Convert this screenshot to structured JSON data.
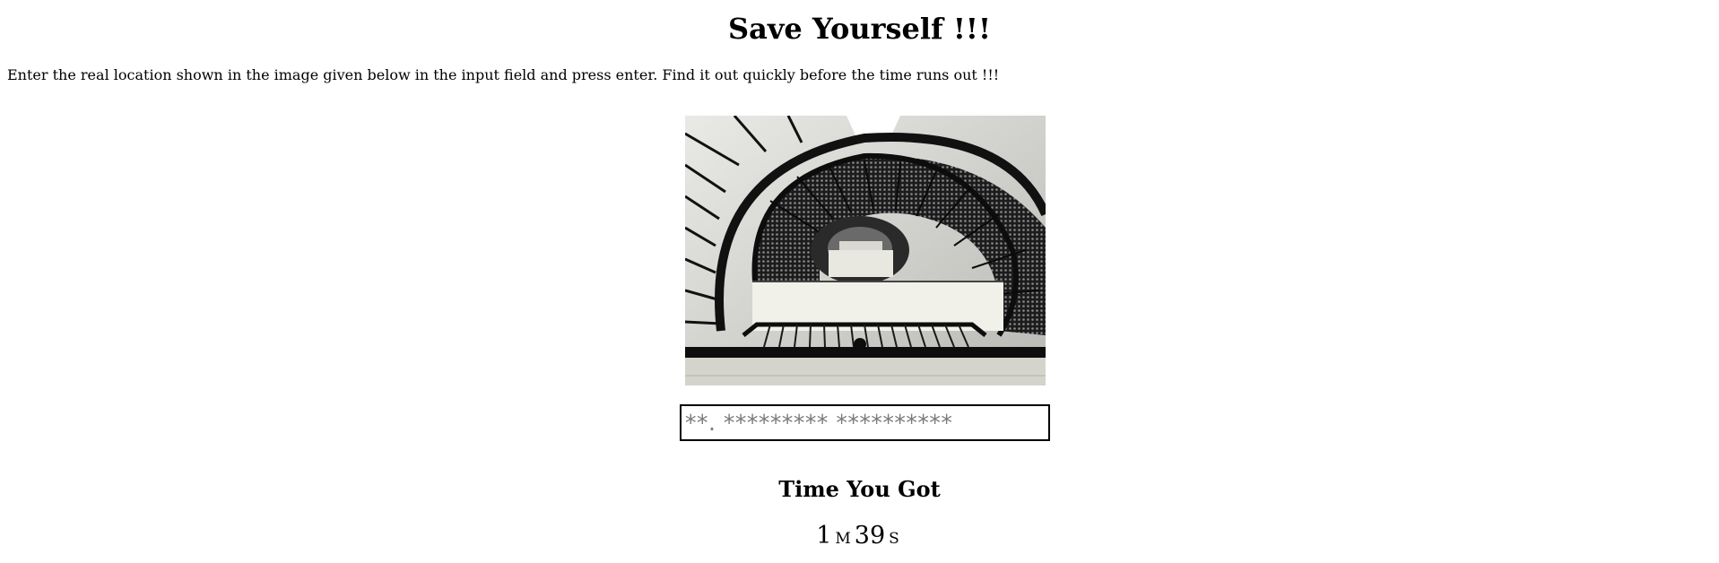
{
  "header": {
    "title": "Save Yourself !!!"
  },
  "instructions": "Enter the real location shown in the image given below in the input field and press enter. Find it out quickly before the time runs out !!!",
  "puzzle_image": {
    "subject": "spiral staircase viewed from below"
  },
  "answer_input": {
    "value": "",
    "placeholder": "**. ********* **********"
  },
  "timer": {
    "heading": "Time You Got",
    "minutes": "1",
    "minutes_unit": "M",
    "seconds": "39",
    "seconds_unit": "S"
  },
  "colors": {
    "text": "#000000",
    "background": "#ffffff",
    "input_border": "#000000",
    "placeholder": "#7a7a7a"
  }
}
